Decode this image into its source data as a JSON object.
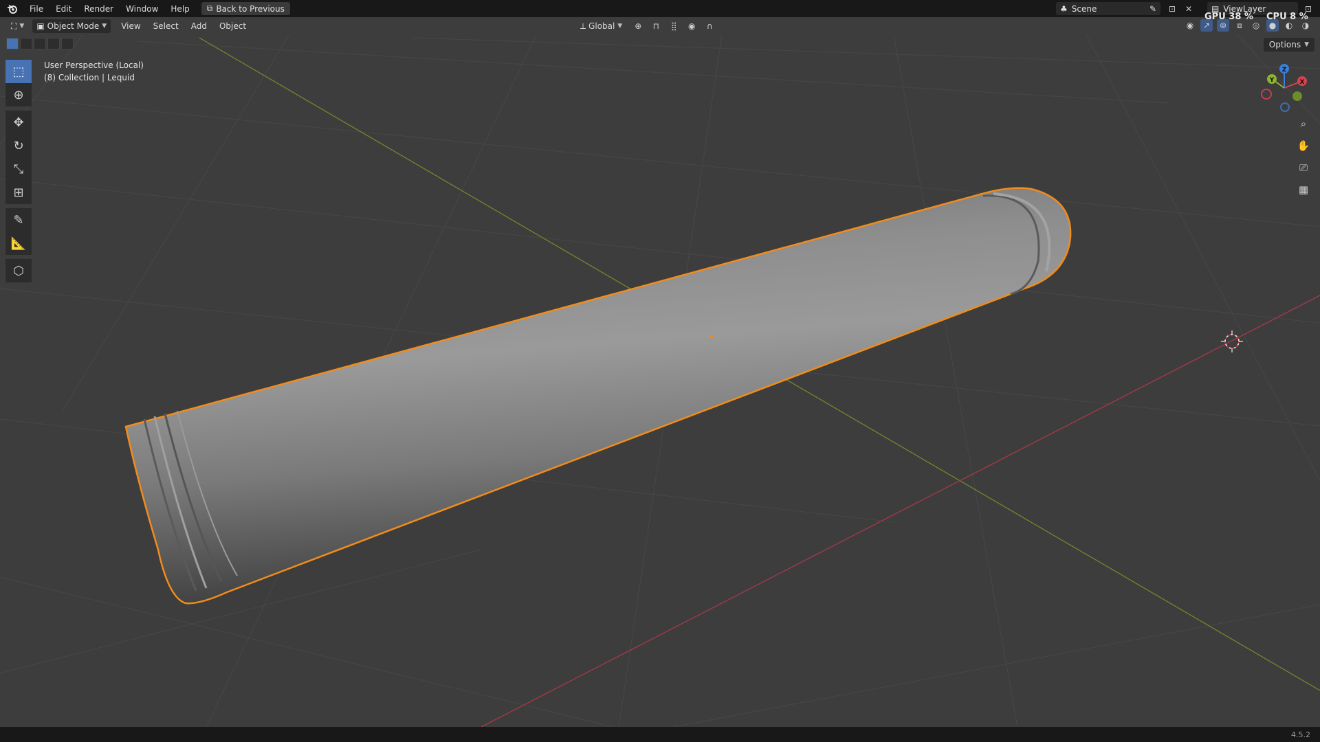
{
  "topbar": {
    "menus": [
      "File",
      "Edit",
      "Render",
      "Window",
      "Help"
    ],
    "back_label": "Back to Previous",
    "scene_label": "Scene",
    "viewlayer_label": "ViewLayer",
    "gpu_text": "GPU 38 %",
    "cpu_text": "CPU 8 %"
  },
  "header": {
    "mode_label": "Object Mode",
    "menus": [
      "View",
      "Select",
      "Add",
      "Object"
    ],
    "transform_orientation": "Global",
    "options_label": "Options"
  },
  "viewport": {
    "perspective_label": "User Perspective (Local)",
    "collection_label": "(8) Collection | Lequid"
  },
  "gizmo": {
    "x_label": "X",
    "y_label": "Y",
    "z_label": "Z"
  },
  "status": {
    "version": "4.5.2"
  },
  "colors": {
    "background": "#3d3d3d",
    "selection_outline": "#f28c1a",
    "accent": "#4772b3",
    "axis_x": "#c2404f",
    "axis_y": "#7e9c2c"
  },
  "toolbar_icons": [
    "select-box-icon",
    "cursor-icon",
    "move-icon",
    "rotate-icon",
    "scale-icon",
    "transform-icon",
    "annotate-icon",
    "measure-icon",
    "add-cube-icon"
  ]
}
